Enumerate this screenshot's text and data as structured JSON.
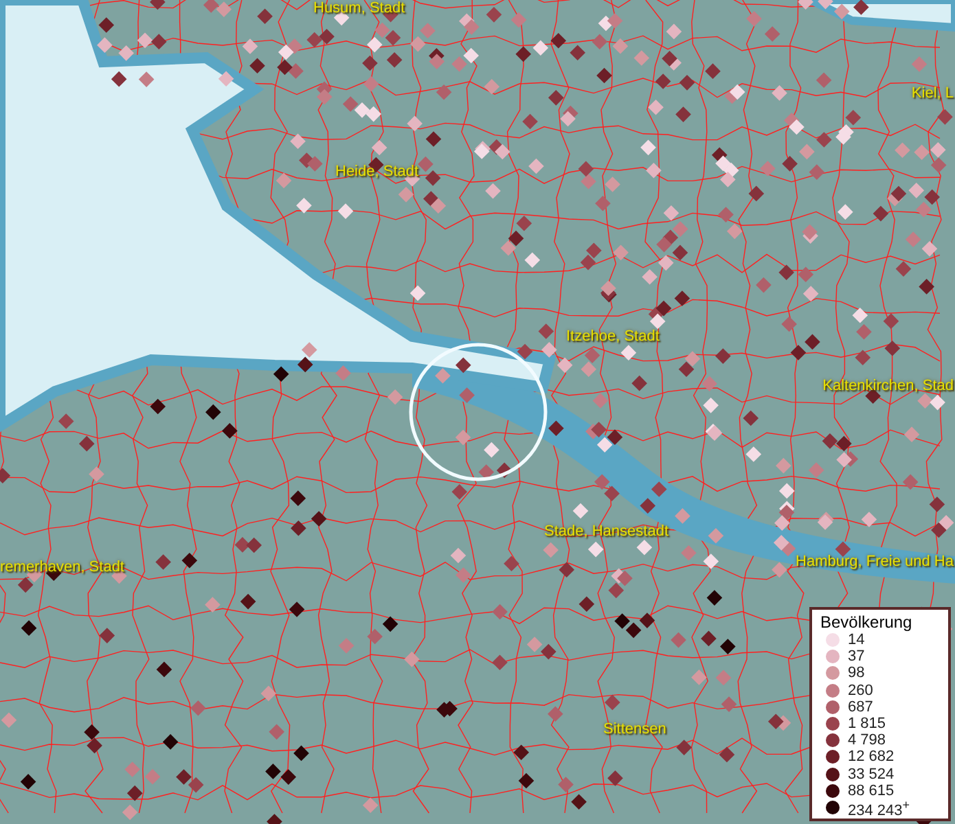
{
  "place_labels": [
    {
      "name": "Husum, Stadt"
    },
    {
      "name": "Kiel, L"
    },
    {
      "name": "Heide, Stadt"
    },
    {
      "name": "Itzehoe, Stadt"
    },
    {
      "name": "Kaltenkirchen, Stad"
    },
    {
      "name": "Stade, Hansestadt"
    },
    {
      "name": "remerhaven, Stadt"
    },
    {
      "name": "Hamburg, Freie und Ha"
    },
    {
      "name": "Sittensen"
    }
  ],
  "legend": {
    "title": "Bevölkerung",
    "items": [
      {
        "label": "14",
        "color": "#f5dde6"
      },
      {
        "label": "37",
        "color": "#e4b5c0"
      },
      {
        "label": "98",
        "color": "#d4999f"
      },
      {
        "label": "260",
        "color": "#c47d86"
      },
      {
        "label": "687",
        "color": "#b0606a"
      },
      {
        "label": "1 815",
        "color": "#9a434d"
      },
      {
        "label": "4 798",
        "color": "#85323c"
      },
      {
        "label": "12 682",
        "color": "#6d1f27"
      },
      {
        "label": "33 524",
        "color": "#551217"
      },
      {
        "label": "88 615",
        "color": "#3c080c"
      },
      {
        "label": "234 243$^{+}$",
        "color": "#220305"
      }
    ]
  }
}
